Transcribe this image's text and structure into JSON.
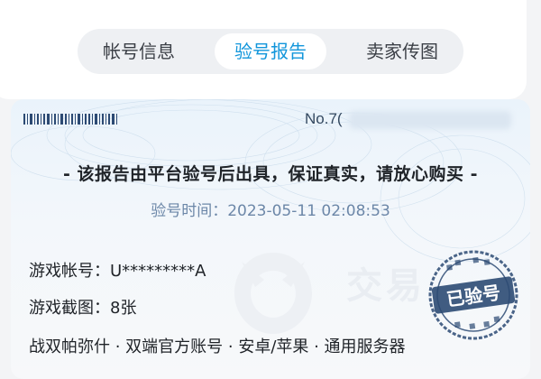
{
  "tabs": [
    {
      "label": "帐号信息",
      "active": false
    },
    {
      "label": "验号报告",
      "active": true
    },
    {
      "label": "卖家传图",
      "active": false
    }
  ],
  "report": {
    "number_prefix": "No.7(",
    "title": "- 该报告由平台验号后出具，保证真实，请放心购买 -",
    "verify_time": "验号时间：2023-05-11 02:08:53",
    "account_line": "游戏帐号：U*********A",
    "screenshot_line": "游戏截图：8张",
    "game_line": "战双帕弥什 · 双端官方账号 · 安卓/苹果 · 通用服务器",
    "stamp_text": "已验号",
    "watermark": "交易"
  },
  "colors": {
    "accent": "#1296db",
    "stamp": "#2c4a73"
  }
}
